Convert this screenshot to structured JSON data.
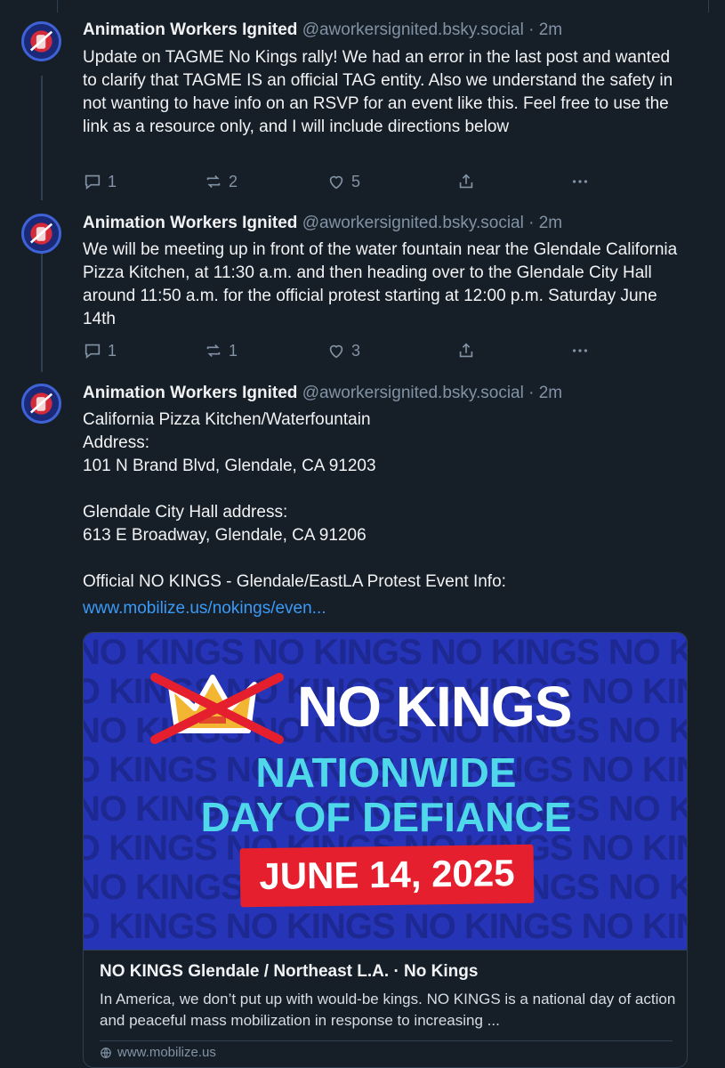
{
  "colors": {
    "background": "#161e27",
    "text": "#f1f3f5",
    "muted": "#8293a5",
    "link": "#3b9af8",
    "border": "#2e4052",
    "banner_blue": "#2634b8",
    "banner_cyan": "#4fd8ea",
    "banner_red": "#e51f2d"
  },
  "posts": [
    {
      "author_name": "Animation Workers Ignited",
      "handle": "@aworkersignited.bsky.social",
      "time": "· 2m",
      "text": "Update on TAGME No Kings rally! We had an error in the last post and wanted to clarify that TAGME IS an official TAG entity. Also we understand the safety in not wanting to have info on an RSVP for an event like this. Feel free to use the link as a resource only, and I will include directions below",
      "replies": "1",
      "reposts": "2",
      "likes": "5"
    },
    {
      "author_name": "Animation Workers Ignited",
      "handle": "@aworkersignited.bsky.social",
      "time": "· 2m",
      "text": "We will be meeting up in front of the water fountain near the Glendale California Pizza Kitchen, at 11:30 a.m. and then heading over to the Glendale City Hall around 11:50 a.m. for the official protest starting at 12:00 p.m. Saturday June 14th",
      "replies": "1",
      "reposts": "1",
      "likes": "3"
    },
    {
      "author_name": "Animation Workers Ignited",
      "handle": "@aworkersignited.bsky.social",
      "time": "· 2m",
      "text": "California Pizza Kitchen/Waterfountain\nAddress:\n101 N Brand Blvd, Glendale, CA 91203\n\nGlendale City Hall address:\n613 E Broadway, Glendale, CA 91206\n\nOfficial NO KINGS - Glendale/EastLA Protest Event Info:",
      "link_text": "www.mobilize.us/nokings/even..."
    }
  ],
  "link_card": {
    "banner_title": "NO KINGS",
    "banner_line1": "NATIONWIDE",
    "banner_line2": "DAY OF DEFIANCE",
    "banner_date": "JUNE 14, 2025",
    "banner_bg_text": "NO KINGS NO KINGS NO KINGS NO KINGS NO KINGS NO KINGS",
    "title": "NO KINGS Glendale / Northeast L.A. · No Kings",
    "description": "In America, we don’t put up with would-be kings. NO KINGS is a national day of action and peaceful mass mobilization in response to increasing ...",
    "domain": "www.mobilize.us"
  },
  "icons": {
    "reply": "reply-icon",
    "repost": "repost-icon",
    "like": "heart-icon",
    "share": "share-icon",
    "more": "more-icon",
    "globe": "globe-icon"
  }
}
